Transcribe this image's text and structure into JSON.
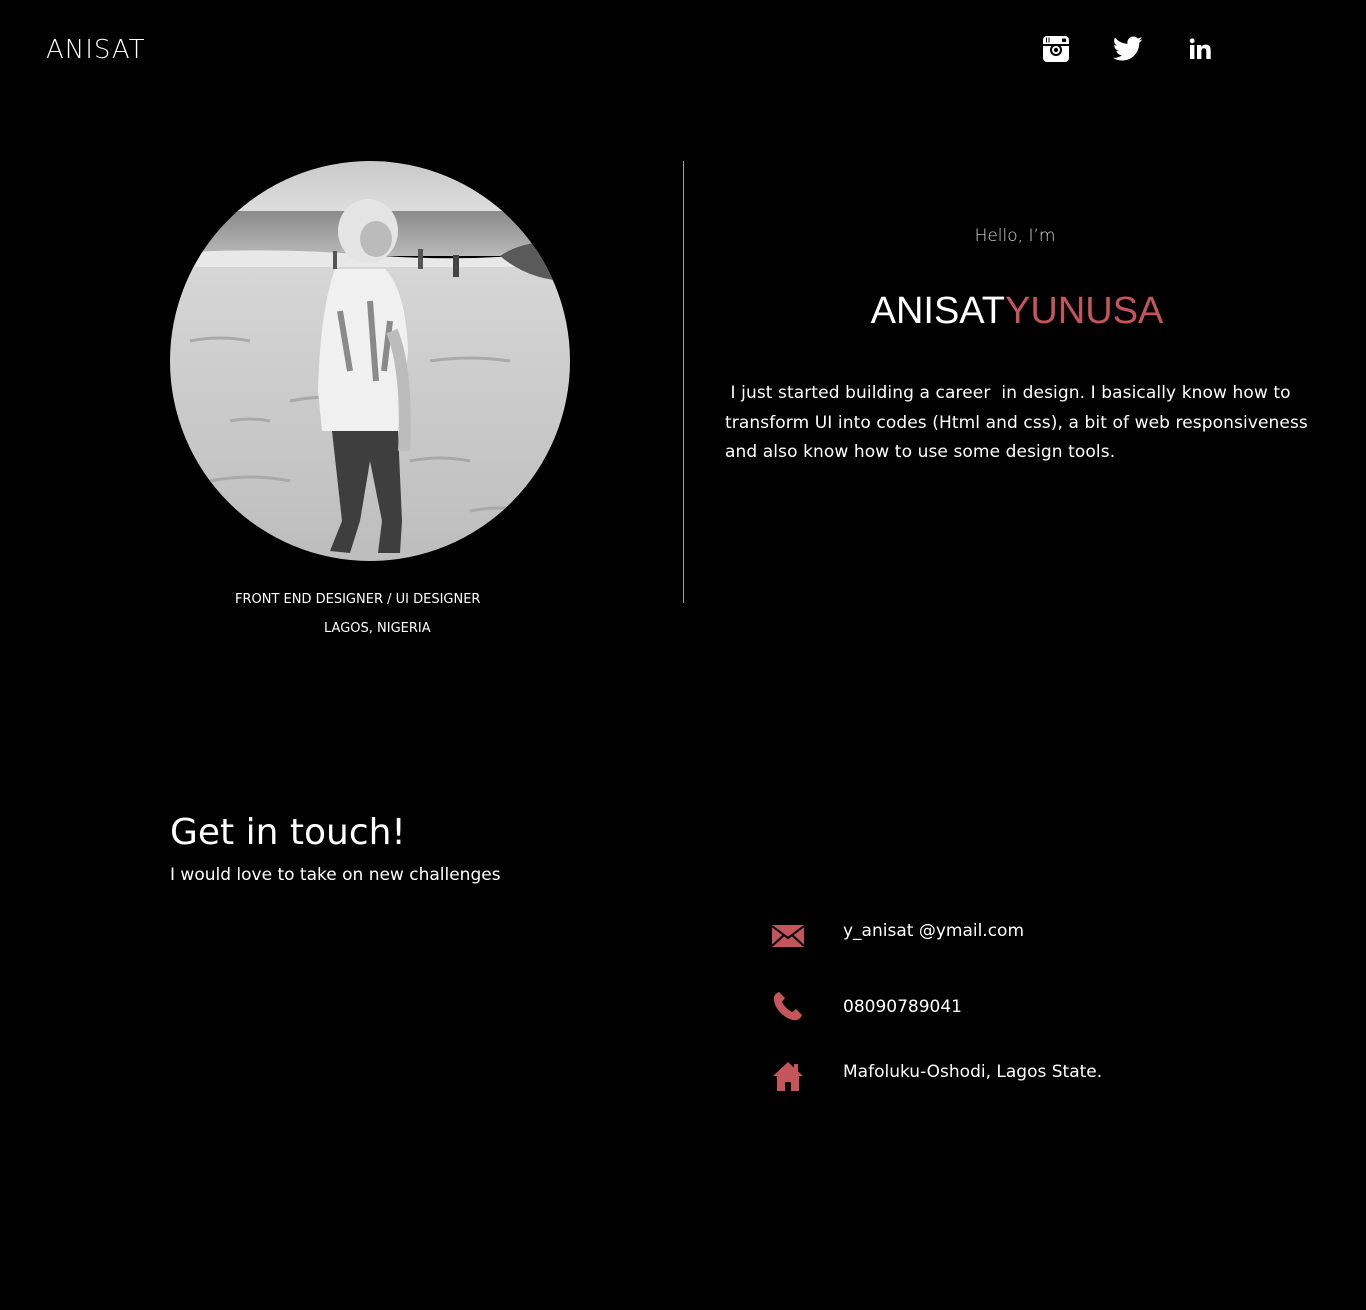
{
  "header": {
    "logo": "ANISAT",
    "social": [
      {
        "name": "instagram-icon"
      },
      {
        "name": "twitter-icon"
      },
      {
        "name": "linkedin-icon"
      }
    ]
  },
  "profile": {
    "role": "FRONT END DESIGNER / UI DESIGNER",
    "location": "LAGOS, NIGERIA"
  },
  "intro": {
    "greeting": "Hello, I’m",
    "first_name": "ANISAT",
    "last_name": "YUNUSA",
    "bio": " I just started building a career  in design. I basically know how to transform UI into codes (Html and css), a bit of web responsiveness and also know how to use some design tools."
  },
  "contact": {
    "heading": "Get in touch!",
    "subheading": "I would love to take on new challenges",
    "email": "y_anisat @ymail.com",
    "phone": "08090789041",
    "address": "Mafoluku-Oshodi, Lagos State."
  },
  "colors": {
    "background": "#000000",
    "accent": "#c4555b",
    "text": "#ffffff"
  }
}
